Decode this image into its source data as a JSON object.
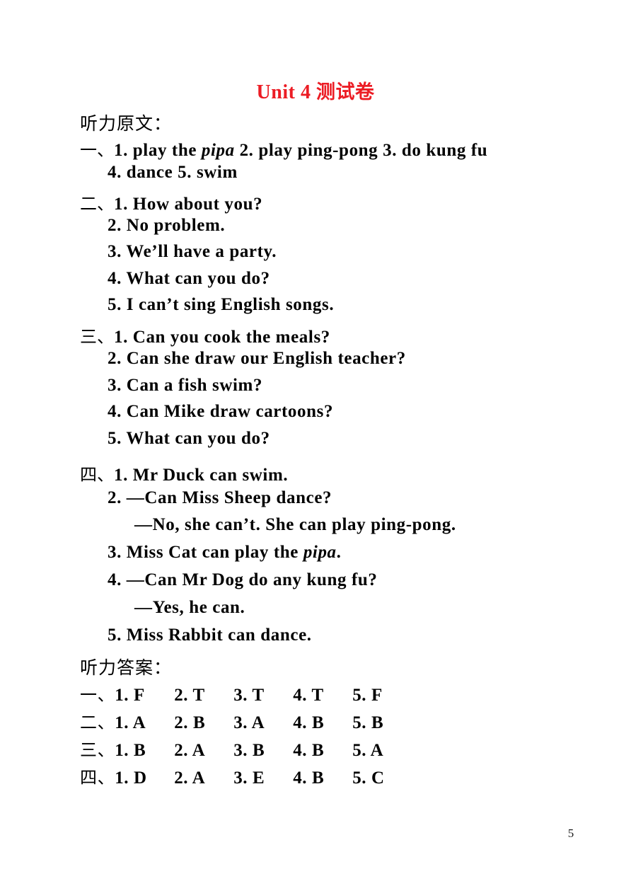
{
  "document": {
    "title_en": "Unit 4",
    "title_cn": "测试卷",
    "title_color": "#ec1c24",
    "page_number": "5"
  },
  "script_section": {
    "heading": "听力原文："
  },
  "answers_section": {
    "heading": "听力答案："
  },
  "markers": {
    "one": "一、",
    "two": "二、",
    "three": "三、",
    "four": "四、"
  },
  "script": {
    "part1": {
      "line1": "1. play the ",
      "line1_italic": "pipa",
      "line1_rest": "   2. play ping-pong   3. do kung fu",
      "line2": "4. dance   5. swim"
    },
    "part2": {
      "item1": "1. How about you?",
      "item2": "2. No problem.",
      "item3": "3. We’ll have a party.",
      "item4": "4. What can you do?",
      "item5": "5. I can’t sing English songs."
    },
    "part3": {
      "item1": "1. Can you cook the meals?",
      "item2": "2. Can she draw our English teacher?",
      "item3": "3. Can a fish swim?",
      "item4": "4. Can Mike draw cartoons?",
      "item5": "5. What can you do?"
    },
    "part4": {
      "item1": "1. Mr Duck can swim.",
      "item2_q": "2. —Can Miss Sheep dance?",
      "item2_a": "—No, she can’t. She can play ping-pong.",
      "item3_pre": "3. Miss Cat can play the ",
      "item3_italic": "pipa",
      "item3_post": ".",
      "item4_q": "4. —Can Mr Dog do any kung fu?",
      "item4_a": "—Yes, he can.",
      "item5": "5. Miss Rabbit can dance."
    }
  },
  "answers": {
    "rows": [
      {
        "marker": "一、",
        "cells": [
          "1. F",
          "2. T",
          "3. T",
          "4. T",
          "5. F"
        ]
      },
      {
        "marker": "二、",
        "cells": [
          "1. A",
          "2. B",
          "3. A",
          "4. B",
          "5. B"
        ]
      },
      {
        "marker": "三、",
        "cells": [
          "1. B",
          "2. A",
          "3. B",
          "4. B",
          "5. A"
        ]
      },
      {
        "marker": "四、",
        "cells": [
          "1. D",
          "2. A",
          "3. E",
          "4. B",
          "5. C"
        ]
      }
    ]
  }
}
